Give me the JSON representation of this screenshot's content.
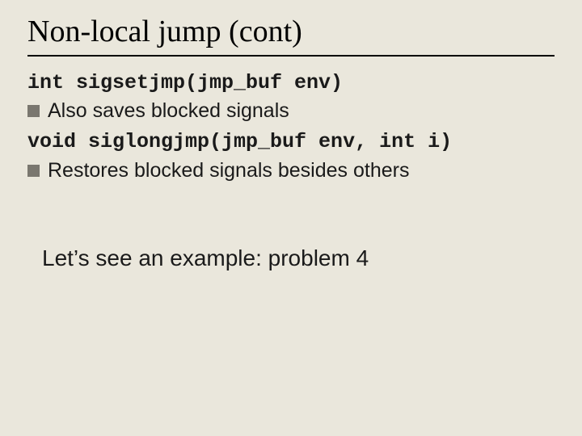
{
  "title": "Non-local jump (cont)",
  "code1": "int sigsetjmp(jmp_buf env)",
  "bullet1": "Also saves blocked signals",
  "code2": "void siglongjmp(jmp_buf env, int i)",
  "bullet2": "Restores blocked signals besides others",
  "example": "Let’s see an example: problem 4"
}
